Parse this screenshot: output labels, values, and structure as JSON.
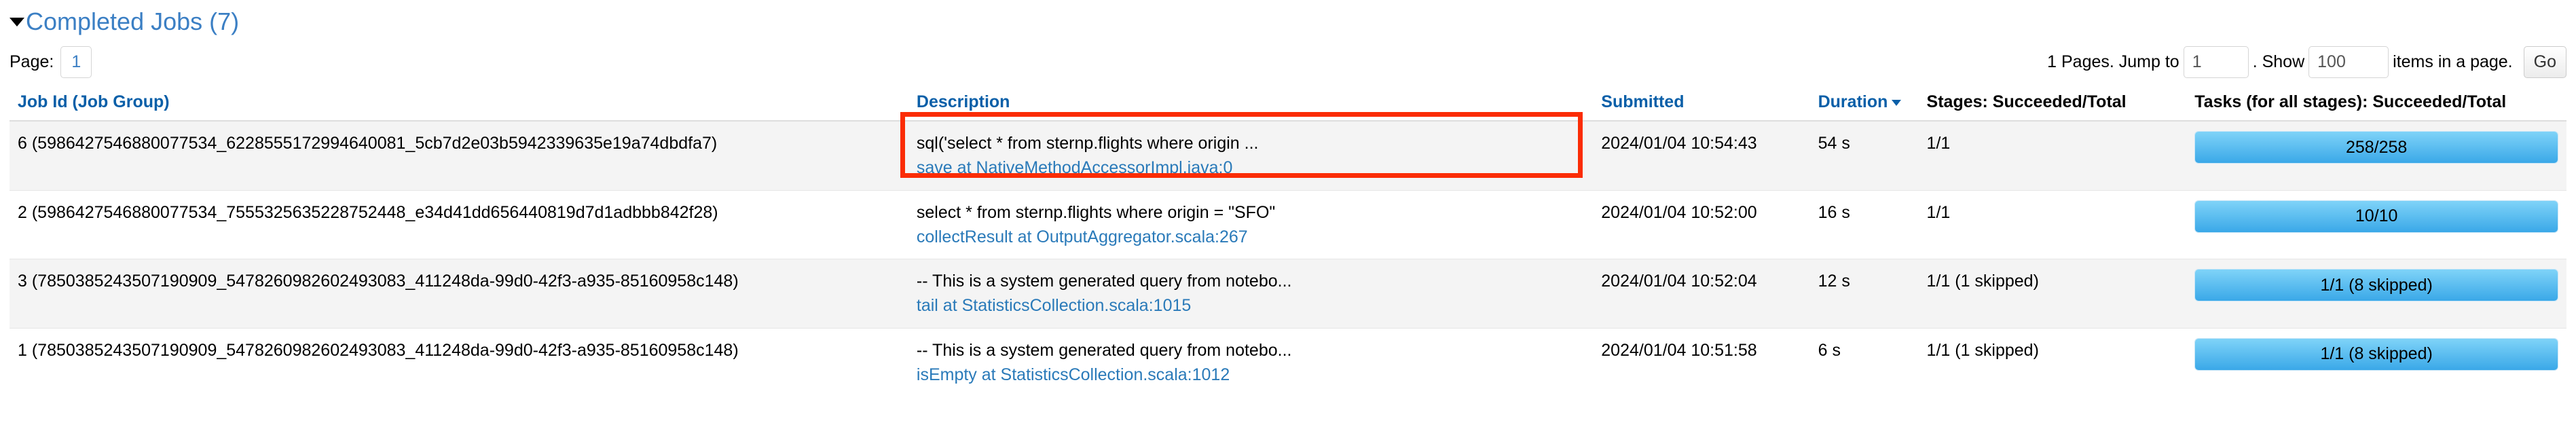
{
  "section": {
    "title": "Completed Jobs (7)",
    "caret_icon": "triangle-down-icon"
  },
  "pager": {
    "page_label": "Page:",
    "current_page": "1",
    "pages_prefix": "1 Pages. Jump to",
    "jump_value": "1",
    "jump_placeholder": "1",
    "show_prefix": ". Show",
    "show_value": "100",
    "show_placeholder": "100",
    "items_suffix": "items in a page.",
    "go_label": "Go"
  },
  "table": {
    "headers": {
      "job_id": "Job Id (Job Group)",
      "description": "Description",
      "submitted": "Submitted",
      "duration": "Duration",
      "duration_sort_icon": "sort-descending-icon",
      "stages": "Stages: Succeeded/Total",
      "tasks": "Tasks (for all stages): Succeeded/Total"
    },
    "rows": [
      {
        "job_id": "6 (5986427546880077534_6228555172994640081_5cb7d2e03b5942339635e19a74dbdfa7)",
        "desc_text": "sql('select * from sternp.flights where origin ...",
        "desc_link": "save at NativeMethodAccessorImpl.java:0",
        "submitted": "2024/01/04 10:54:43",
        "duration": "54 s",
        "stages": "1/1",
        "tasks": "258/258",
        "tasks_percent": 100,
        "highlighted": true
      },
      {
        "job_id": "2 (5986427546880077534_7555325635228752448_e34d41dd656440819d7d1adbbb842f28)",
        "desc_text": "select * from sternp.flights where origin = \"SFO\"",
        "desc_link": "collectResult at OutputAggregator.scala:267",
        "submitted": "2024/01/04 10:52:00",
        "duration": "16 s",
        "stages": "1/1",
        "tasks": "10/10",
        "tasks_percent": 100,
        "highlighted": false
      },
      {
        "job_id": "3 (7850385243507190909_5478260982602493083_411248da-99d0-42f3-a935-85160958c148)",
        "desc_text": "-- This is a system generated query from notebo...",
        "desc_link": "tail at StatisticsCollection.scala:1015",
        "submitted": "2024/01/04 10:52:04",
        "duration": "12 s",
        "stages": "1/1 (1 skipped)",
        "tasks": "1/1 (8 skipped)",
        "tasks_percent": 100,
        "highlighted": false
      },
      {
        "job_id": "1 (7850385243507190909_5478260982602493083_411248da-99d0-42f3-a935-85160958c148)",
        "desc_text": "-- This is a system generated query from notebo...",
        "desc_link": "isEmpty at StatisticsCollection.scala:1012",
        "submitted": "2024/01/04 10:51:58",
        "duration": "6 s",
        "stages": "1/1 (1 skipped)",
        "tasks": "1/1 (8 skipped)",
        "tasks_percent": 100,
        "highlighted": false
      }
    ]
  },
  "colors": {
    "link": "#2a7ab9",
    "header_link": "#0a5fa8",
    "annotation": "#fb2c05",
    "progress": "#3aa8e8"
  }
}
